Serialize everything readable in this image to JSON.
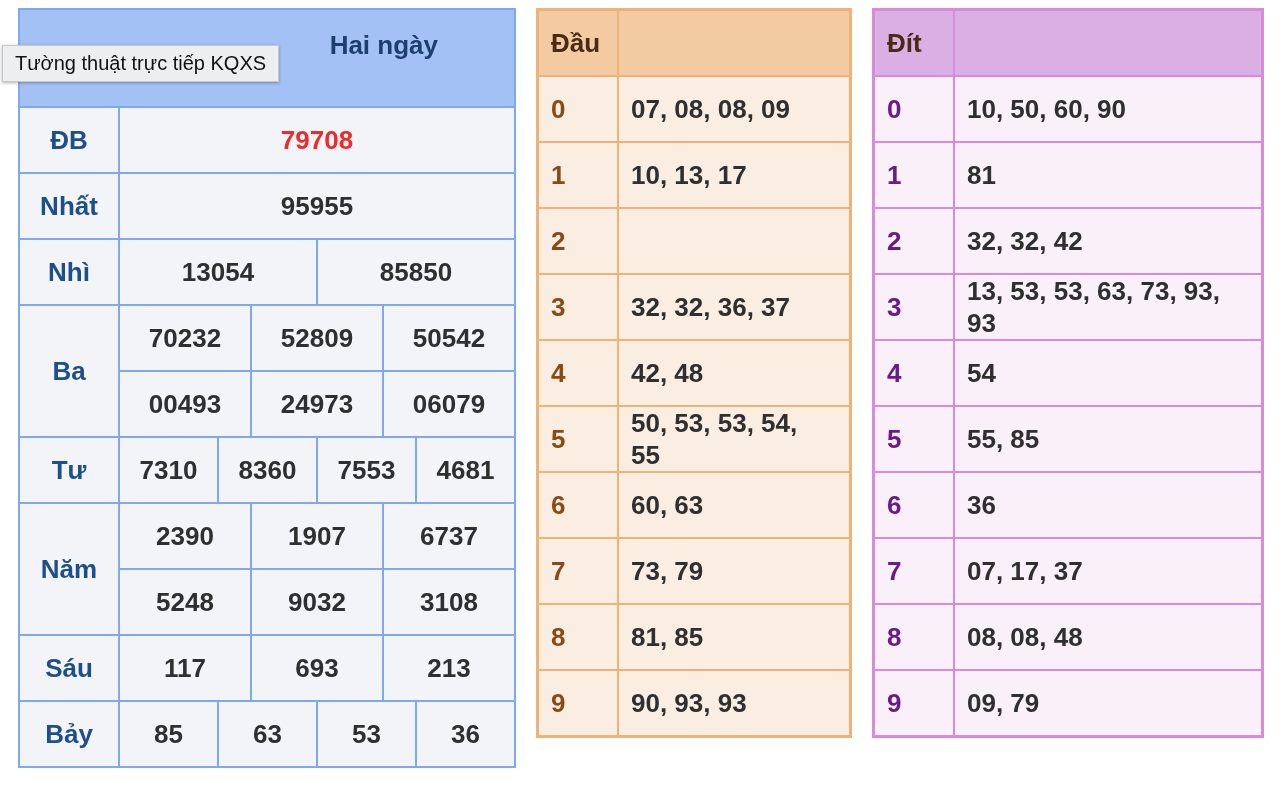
{
  "results": {
    "title": "Hai ngày",
    "prizes": [
      {
        "label": "ĐB",
        "kind": "special",
        "numbers": [
          "79708"
        ]
      },
      {
        "label": "Nhất",
        "kind": "normal",
        "numbers": [
          "95955"
        ]
      },
      {
        "label": "Nhì",
        "kind": "normal",
        "numbers": [
          "13054",
          "85850"
        ]
      },
      {
        "label": "Ba",
        "kind": "normal",
        "numbers": [
          "70232",
          "52809",
          "50542",
          "00493",
          "24973",
          "06079"
        ]
      },
      {
        "label": "Tư",
        "kind": "normal",
        "numbers": [
          "7310",
          "8360",
          "7553",
          "4681"
        ]
      },
      {
        "label": "Năm",
        "kind": "normal",
        "numbers": [
          "2390",
          "1907",
          "6737",
          "5248",
          "9032",
          "3108"
        ]
      },
      {
        "label": "Sáu",
        "kind": "normal",
        "numbers": [
          "117",
          "693",
          "213"
        ]
      },
      {
        "label": "Bảy",
        "kind": "normal",
        "numbers": [
          "85",
          "63",
          "53",
          "36"
        ]
      }
    ]
  },
  "tooltip": "Tường thuật trực tiếp KQXS",
  "dau_table": {
    "heading": "Đầu",
    "rows": [
      {
        "digit": "0",
        "numbers": "07, 08, 08, 09"
      },
      {
        "digit": "1",
        "numbers": "10, 13, 17"
      },
      {
        "digit": "2",
        "numbers": ""
      },
      {
        "digit": "3",
        "numbers": "32, 32, 36, 37"
      },
      {
        "digit": "4",
        "numbers": "42, 48"
      },
      {
        "digit": "5",
        "numbers": "50, 53, 53, 54, 55"
      },
      {
        "digit": "6",
        "numbers": "60, 63"
      },
      {
        "digit": "7",
        "numbers": "73, 79"
      },
      {
        "digit": "8",
        "numbers": "81, 85"
      },
      {
        "digit": "9",
        "numbers": "90, 93, 93"
      }
    ]
  },
  "dit_table": {
    "heading": "Đít",
    "rows": [
      {
        "digit": "0",
        "numbers": "10, 50, 60, 90"
      },
      {
        "digit": "1",
        "numbers": "81"
      },
      {
        "digit": "2",
        "numbers": "32, 32, 42"
      },
      {
        "digit": "3",
        "numbers": "13, 53, 53, 63, 73, 93, 93"
      },
      {
        "digit": "4",
        "numbers": "54"
      },
      {
        "digit": "5",
        "numbers": "55, 85"
      },
      {
        "digit": "6",
        "numbers": "36"
      },
      {
        "digit": "7",
        "numbers": "07, 17, 37"
      },
      {
        "digit": "8",
        "numbers": "08, 08, 48"
      },
      {
        "digit": "9",
        "numbers": "09, 79"
      }
    ]
  }
}
